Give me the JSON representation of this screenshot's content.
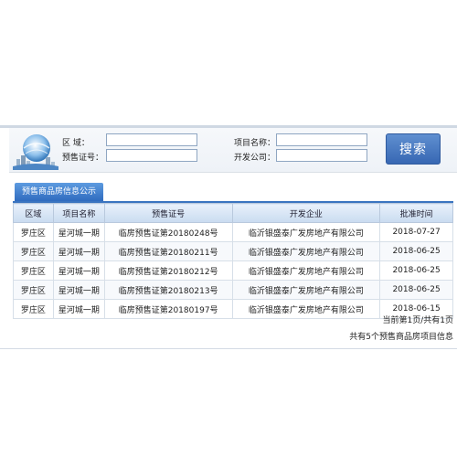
{
  "search": {
    "region_label": "区    域：",
    "project_label": "项目名称：",
    "permit_label": "预售证号：",
    "developer_label": "开发公司：",
    "region_value": "",
    "project_value": "",
    "permit_value": "",
    "developer_value": "",
    "button_label": "搜索"
  },
  "section": {
    "tab_label": "预售商品房信息公示"
  },
  "table": {
    "headers": [
      "区域",
      "项目名称",
      "预售证号",
      "开发企业",
      "批准时间"
    ],
    "rows": [
      [
        "罗庄区",
        "星河城一期",
        "临房预售证第20180248号",
        "临沂银盛泰广发房地产有限公司",
        "2018-07-27"
      ],
      [
        "罗庄区",
        "星河城一期",
        "临房预售证第20180211号",
        "临沂银盛泰广发房地产有限公司",
        "2018-06-25"
      ],
      [
        "罗庄区",
        "星河城一期",
        "临房预售证第20180212号",
        "临沂银盛泰广发房地产有限公司",
        "2018-06-25"
      ],
      [
        "罗庄区",
        "星河城一期",
        "临房预售证第20180213号",
        "临沂银盛泰广发房地产有限公司",
        "2018-06-25"
      ],
      [
        "罗庄区",
        "星河城一期",
        "临房预售证第20180197号",
        "临沂银盛泰广发房地产有限公司",
        "2018-06-15"
      ]
    ]
  },
  "pager": {
    "text": "当前第1页/共有1页",
    "summary": "共有5个预售商品房项目信息"
  },
  "colors": {
    "accent": "#3a74c0",
    "button": "#4a7cc4"
  }
}
